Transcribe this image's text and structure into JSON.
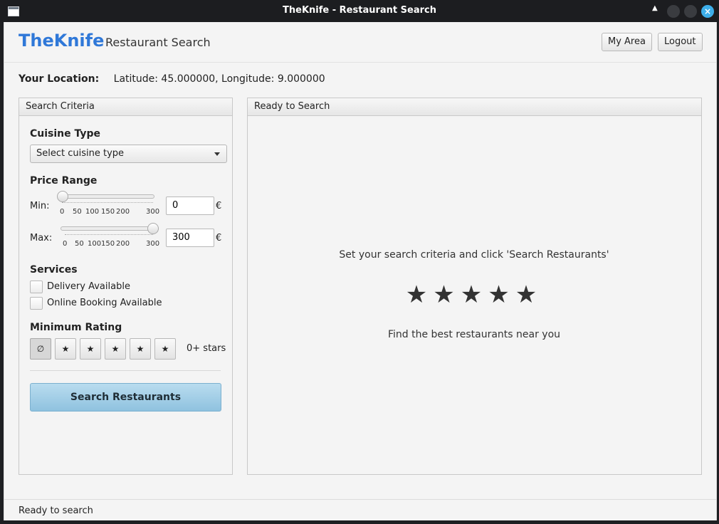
{
  "window": {
    "title": "TheKnife - Restaurant Search"
  },
  "header": {
    "brand": "TheKnife",
    "subtitle": "Restaurant Search",
    "my_area_label": "My Area",
    "logout_label": "Logout"
  },
  "location": {
    "label": "Your Location:",
    "value": "Latitude: 45.000000, Longitude: 9.000000"
  },
  "search_panel": {
    "title": "Search Criteria",
    "cuisine": {
      "label": "Cuisine Type",
      "selected": "Select cuisine type"
    },
    "price": {
      "label": "Price Range",
      "min_label": "Min:",
      "max_label": "Max:",
      "currency": "€",
      "ticks": [
        "0",
        "50",
        "100",
        "150",
        "200",
        "300"
      ],
      "min_value": "0",
      "max_value": "300"
    },
    "services": {
      "label": "Services",
      "delivery": "Delivery Available",
      "online_booking": "Online Booking Available"
    },
    "rating": {
      "label": "Minimum Rating",
      "buttons": [
        "∅",
        "★",
        "★",
        "★",
        "★",
        "★"
      ],
      "value_text": "0+ stars"
    },
    "search_button": "Search Restaurants"
  },
  "results_panel": {
    "title": "Ready to Search",
    "message": "Set your search criteria and click 'Search Restaurants'",
    "stars": "★★★★★",
    "tagline": "Find the best restaurants near you"
  },
  "status_bar": {
    "text": "Ready to search"
  },
  "colors": {
    "brand": "#2f78d8",
    "search_button": "#9ccbe6"
  }
}
